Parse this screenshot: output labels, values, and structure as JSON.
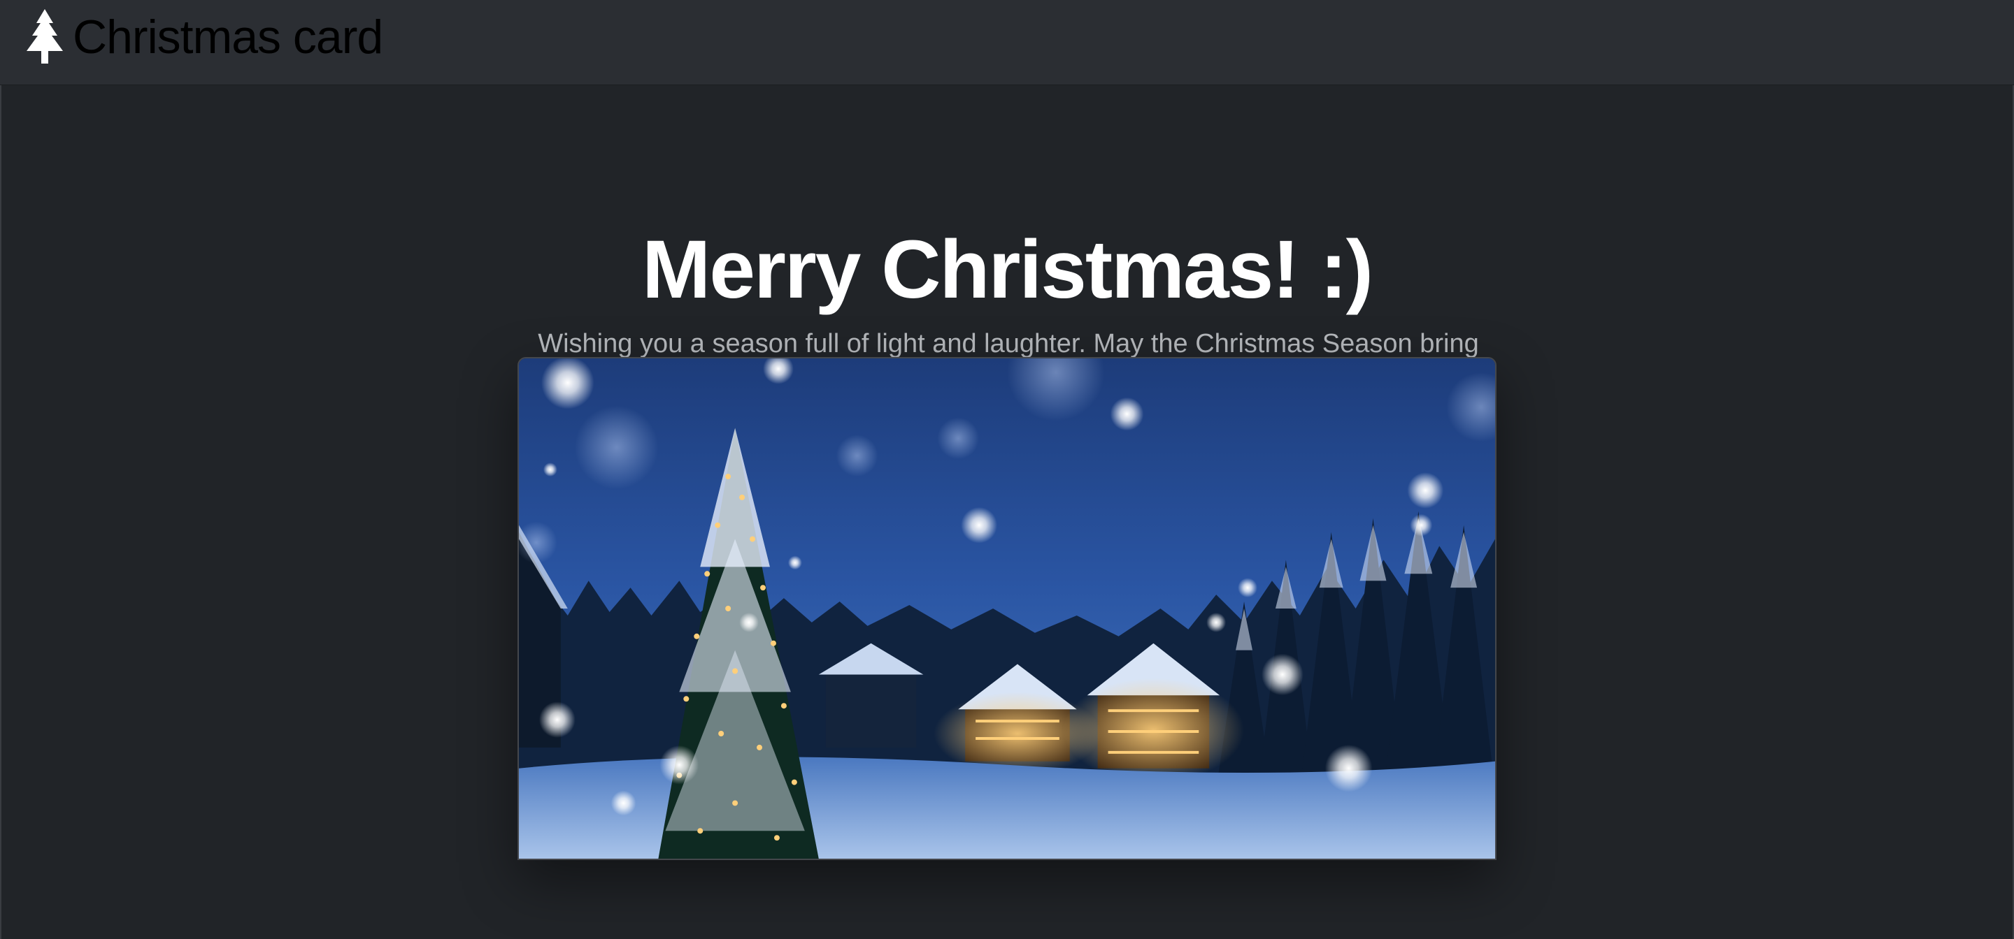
{
  "navbar": {
    "brand_icon": "christmas-tree-icon",
    "brand_label": "Christmas card"
  },
  "hero": {
    "title": "Merry Christmas! :)",
    "lead": "Wishing you a season full of light and laughter. May the Christmas Season bring only happiness and joy to you and your family."
  },
  "image": {
    "alt": "Snowy night village with a lit Christmas tree and illuminated chalets"
  },
  "colors": {
    "background": "#212428",
    "navbar": "#2b2e33",
    "title": "#ffffff",
    "lead": "#b6b9bd"
  }
}
